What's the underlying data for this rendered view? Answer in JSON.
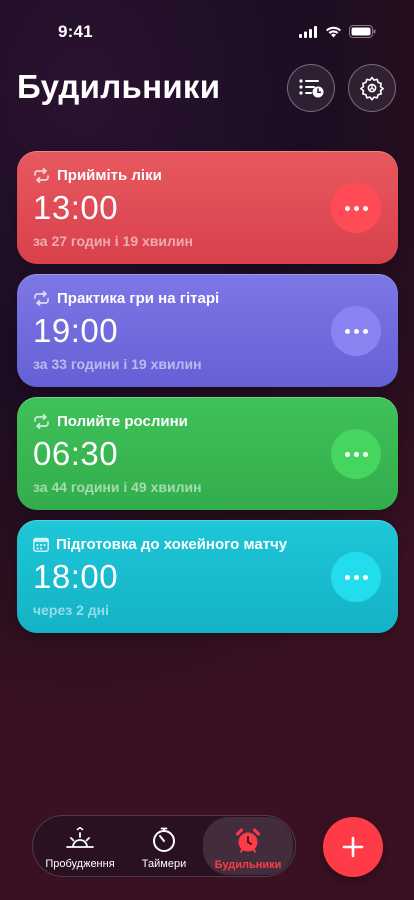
{
  "status_bar": {
    "time": "9:41"
  },
  "header": {
    "title": "Будильники"
  },
  "alarms": [
    {
      "label": "Прийміть ліки",
      "time": "13:00",
      "subtitle": "за 27 годин і 19 хвилин",
      "repeat_icon": "repeat-icon",
      "color": "#dc4650"
    },
    {
      "label": "Практика гри на гітарі",
      "time": "19:00",
      "subtitle": "за 33 години і 19 хвилин",
      "repeat_icon": "repeat-icon",
      "color": "#6e69dc"
    },
    {
      "label": "Полийте рослини",
      "time": "06:30",
      "subtitle": "за 44 години і 49 хвилин",
      "repeat_icon": "repeat-icon",
      "color": "#38b552"
    },
    {
      "label": "Підготовка до хокейного матчу",
      "time": "18:00",
      "subtitle": "через 2 дні",
      "repeat_icon": "calendar-icon",
      "color": "#18bccf"
    }
  ],
  "tabs": [
    {
      "label": "Пробудження",
      "icon": "sunrise-icon"
    },
    {
      "label": "Таймери",
      "icon": "timer-icon"
    },
    {
      "label": "Будильники",
      "icon": "alarm-clock-icon",
      "active": true
    }
  ],
  "accent_color": "#ff3b47"
}
